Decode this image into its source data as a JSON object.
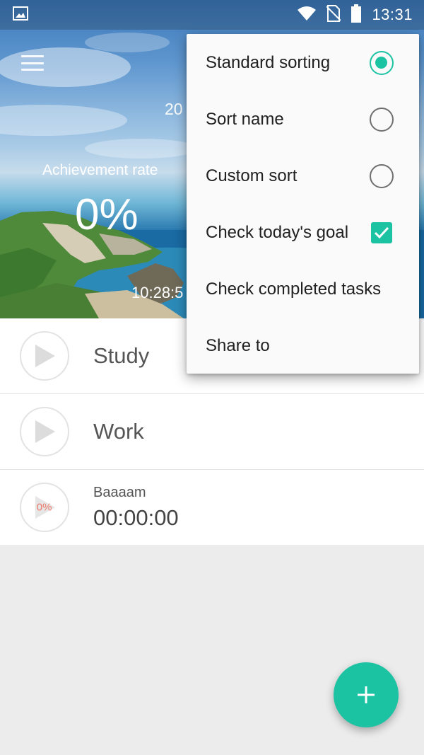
{
  "status_bar": {
    "time": "13:31",
    "icons": [
      "image-notification-icon",
      "wifi-icon",
      "no-sim-icon",
      "battery-icon"
    ]
  },
  "header": {
    "menu_icon": "hamburger-menu-icon",
    "date_partial": "20",
    "achievement_label": "Achievement rate",
    "achievement_value": "0%",
    "time_partial": "10:28:5"
  },
  "tasks": [
    {
      "name": "Study",
      "icon": "play-icon"
    },
    {
      "name": "Work",
      "icon": "play-icon"
    },
    {
      "name": "Baaaam",
      "time": "00:00:00",
      "progress": "0%",
      "icon": "play-icon"
    }
  ],
  "popup_menu": {
    "items": [
      {
        "label": "Standard sorting",
        "control": "radio",
        "checked": true
      },
      {
        "label": "Sort name",
        "control": "radio",
        "checked": false
      },
      {
        "label": "Custom sort",
        "control": "radio",
        "checked": false
      },
      {
        "label": "Check today's goal",
        "control": "checkbox",
        "checked": true
      },
      {
        "label": "Check completed tasks",
        "control": "none"
      },
      {
        "label": "Share to",
        "control": "none"
      }
    ]
  },
  "fab": {
    "icon": "plus-icon"
  },
  "colors": {
    "accent": "#1bc3a3",
    "progress_text": "#ef7a6c",
    "list_background": "#ececec"
  }
}
